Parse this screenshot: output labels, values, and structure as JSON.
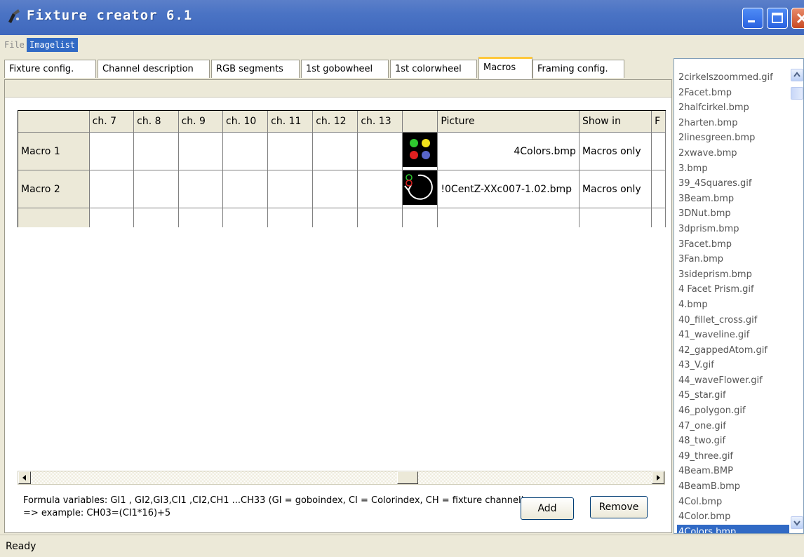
{
  "window": {
    "title": "Fixture creator 6.1"
  },
  "menu": {
    "items": [
      {
        "label": "File"
      },
      {
        "label": "Imagelist"
      }
    ]
  },
  "tabs": [
    {
      "label": "Fixture config."
    },
    {
      "label": "Channel description"
    },
    {
      "label": "RGB segments"
    },
    {
      "label": "1st gobowheel"
    },
    {
      "label": "1st colorwheel"
    },
    {
      "label": "Macros",
      "active": true
    },
    {
      "label": "Framing config."
    }
  ],
  "grid": {
    "columns": [
      "",
      "ch. 7",
      "ch. 8",
      "ch. 9",
      "ch. 10",
      "ch. 11",
      "ch. 12",
      "ch. 13",
      "",
      "Picture",
      "Show in",
      "F"
    ],
    "rows": [
      {
        "name": "Macro 1",
        "picture": "4Colors.bmp",
        "show_in": "Macros only"
      },
      {
        "name": "Macro 2",
        "picture": "!0CentZ-XXc007-1.02.bmp",
        "show_in": "Macros only"
      },
      {
        "name": "",
        "picture": "",
        "show_in": ""
      }
    ]
  },
  "formula": {
    "text": "Formula variables: GI1 , GI2,GI3,CI1 ,CI2,CH1 ...CH33 (GI = goboindex, CI = Colorindex, CH = fixture channel)  => example: CH03=(CI1*16)+5"
  },
  "buttons": {
    "add": "Add",
    "remove": "Remove"
  },
  "imagelist": {
    "items": [
      "2cirkelszoommed.gif",
      "2Facet.bmp",
      "2halfcirkel.bmp",
      "2harten.bmp",
      "2linesgreen.bmp",
      "2xwave.bmp",
      "3.bmp",
      "39_4Squares.gif",
      "3Beam.bmp",
      "3DNut.bmp",
      "3dprism.bmp",
      "3Facet.bmp",
      "3Fan.bmp",
      "3sideprism.bmp",
      "4 Facet Prism.gif",
      "4.bmp",
      "40_fillet_cross.gif",
      "41_waveline.gif",
      "42_gappedAtom.gif",
      "43_V.gif",
      "44_waveFlower.gif",
      "45_star.gif",
      "46_polygon.gif",
      "47_one.gif",
      "48_two.gif",
      "49_three.gif",
      "4Beam.BMP",
      "4BeamB.bmp",
      "4Col.bmp",
      "4Color.bmp",
      "4Colors.bmp"
    ],
    "selected": "4Colors.bmp"
  },
  "status": {
    "text": "Ready"
  },
  "colors": {
    "titlebar": "#4a73c4",
    "selection": "#316ac5",
    "active_tab_accent": "#ffc83c"
  }
}
